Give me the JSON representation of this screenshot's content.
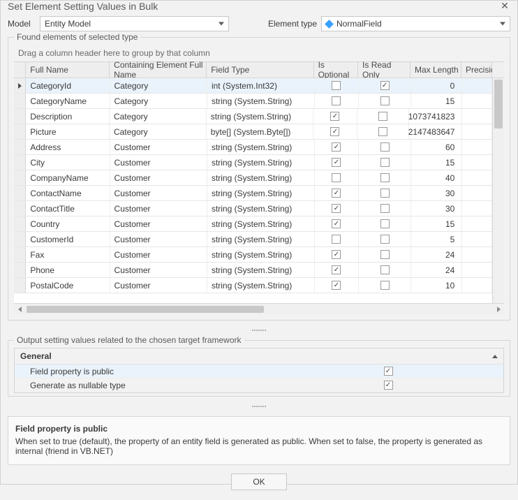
{
  "title": "Set Element Setting Values in Bulk",
  "labels": {
    "model": "Model",
    "elementType": "Element type"
  },
  "modelValue": "Entity Model",
  "elementTypeValue": "NormalField",
  "group1": {
    "label": "Found elements of selected type",
    "groupZone": "Drag a column header here to group by that column",
    "columns": [
      "Full Name",
      "Containing Element Full Name",
      "Field Type",
      "Is Optional",
      "Is Read Only",
      "Max Length",
      "Precision"
    ],
    "rows": [
      {
        "fn": "CategoryId",
        "ce": "Category",
        "ft": "int (System.Int32)",
        "io": false,
        "ro": true,
        "ml": "0",
        "pr": ""
      },
      {
        "fn": "CategoryName",
        "ce": "Category",
        "ft": "string (System.String)",
        "io": false,
        "ro": false,
        "ml": "15",
        "pr": ""
      },
      {
        "fn": "Description",
        "ce": "Category",
        "ft": "string (System.String)",
        "io": true,
        "ro": false,
        "ml": "1073741823",
        "pr": ""
      },
      {
        "fn": "Picture",
        "ce": "Category",
        "ft": "byte[] (System.Byte[])",
        "io": true,
        "ro": false,
        "ml": "2147483647",
        "pr": ""
      },
      {
        "fn": "Address",
        "ce": "Customer",
        "ft": "string (System.String)",
        "io": true,
        "ro": false,
        "ml": "60",
        "pr": ""
      },
      {
        "fn": "City",
        "ce": "Customer",
        "ft": "string (System.String)",
        "io": true,
        "ro": false,
        "ml": "15",
        "pr": ""
      },
      {
        "fn": "CompanyName",
        "ce": "Customer",
        "ft": "string (System.String)",
        "io": false,
        "ro": false,
        "ml": "40",
        "pr": ""
      },
      {
        "fn": "ContactName",
        "ce": "Customer",
        "ft": "string (System.String)",
        "io": true,
        "ro": false,
        "ml": "30",
        "pr": ""
      },
      {
        "fn": "ContactTitle",
        "ce": "Customer",
        "ft": "string (System.String)",
        "io": true,
        "ro": false,
        "ml": "30",
        "pr": ""
      },
      {
        "fn": "Country",
        "ce": "Customer",
        "ft": "string (System.String)",
        "io": true,
        "ro": false,
        "ml": "15",
        "pr": ""
      },
      {
        "fn": "CustomerId",
        "ce": "Customer",
        "ft": "string (System.String)",
        "io": false,
        "ro": false,
        "ml": "5",
        "pr": ""
      },
      {
        "fn": "Fax",
        "ce": "Customer",
        "ft": "string (System.String)",
        "io": true,
        "ro": false,
        "ml": "24",
        "pr": ""
      },
      {
        "fn": "Phone",
        "ce": "Customer",
        "ft": "string (System.String)",
        "io": true,
        "ro": false,
        "ml": "24",
        "pr": ""
      },
      {
        "fn": "PostalCode",
        "ce": "Customer",
        "ft": "string (System.String)",
        "io": true,
        "ro": false,
        "ml": "10",
        "pr": ""
      }
    ]
  },
  "group2": {
    "label": "Output setting values related to the chosen target framework",
    "section": "General",
    "rows": [
      {
        "name": "Field property is public",
        "checked": true,
        "selected": true
      },
      {
        "name": "Generate as nullable type",
        "checked": true,
        "selected": false
      }
    ]
  },
  "description": {
    "heading": "Field property is public",
    "body": "When set to true (default), the property of an entity field is generated as public. When set to false, the property is generated as internal (friend in VB.NET)"
  },
  "okLabel": "OK"
}
